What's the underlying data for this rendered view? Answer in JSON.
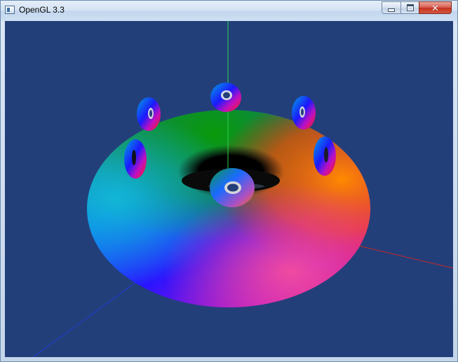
{
  "window": {
    "title": "OpenGL 3.3",
    "icon": "app-window-icon",
    "controls": {
      "minimize_icon": "minimize-icon",
      "maximize_icon": "maximize-icon",
      "close_icon": "close-icon",
      "close_glyph": "✕"
    }
  },
  "viewport": {
    "background": "#233f7a",
    "axes": {
      "x_color": "#c82828",
      "y_color": "#2ed14f",
      "z_color": "#1d3dd6"
    },
    "main_torus": "large-rainbow-torus",
    "small_tori_count": 6
  }
}
